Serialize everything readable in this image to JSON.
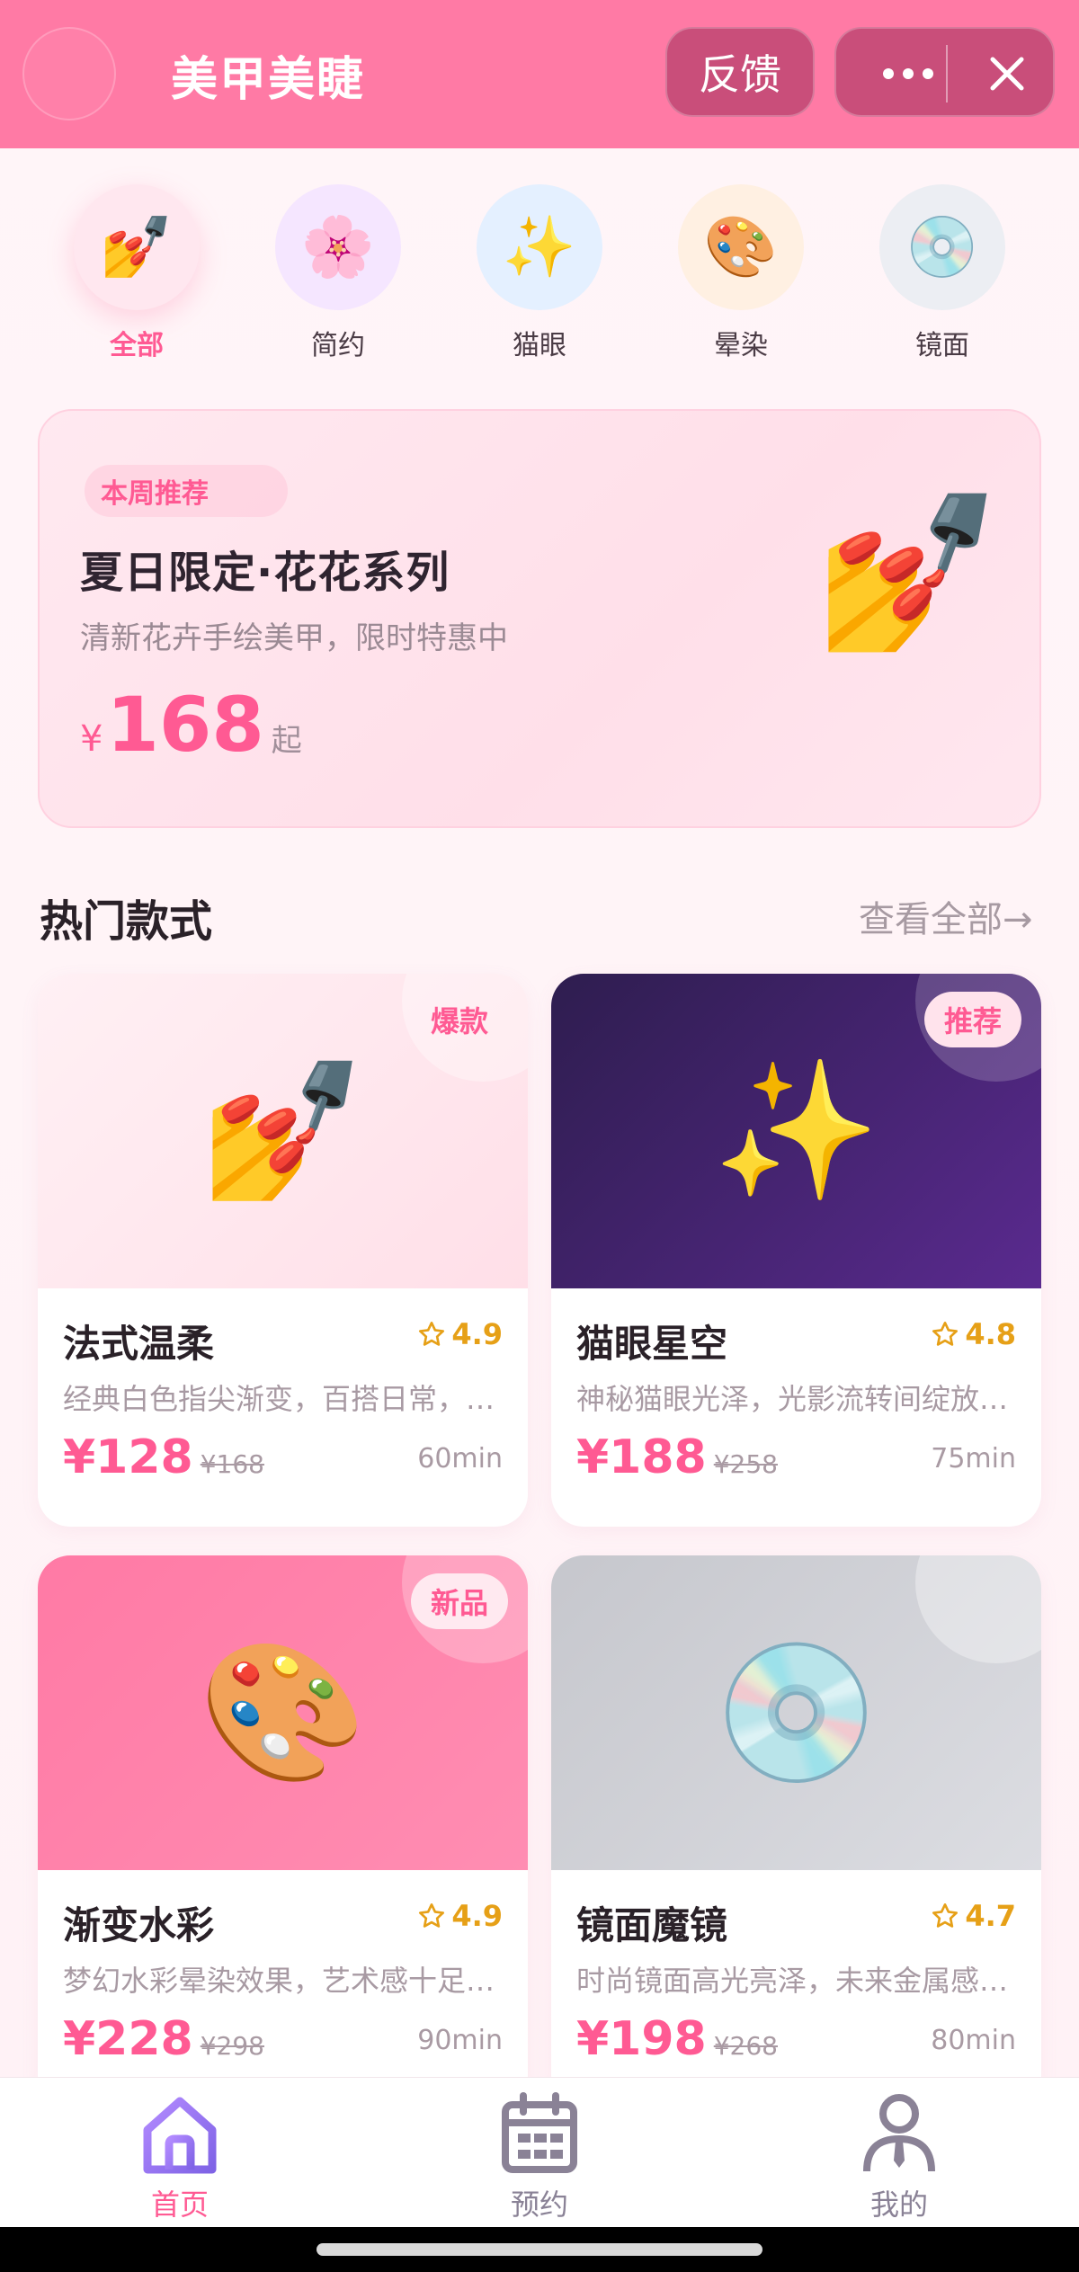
{
  "header": {
    "title": "美甲美睫",
    "feedback_label": "反馈",
    "header_color": "#ff7aa5"
  },
  "categories": [
    {
      "label": "全部",
      "icon": "nail-polish-icon",
      "glyph": "💅",
      "active": true
    },
    {
      "label": "简约",
      "icon": "cherry-blossom-icon",
      "glyph": "🌸",
      "active": false
    },
    {
      "label": "猫眼",
      "icon": "sparkles-icon",
      "glyph": "✨",
      "active": false
    },
    {
      "label": "晕染",
      "icon": "palette-icon",
      "glyph": "🎨",
      "active": false
    },
    {
      "label": "镜面",
      "icon": "dvd-disc-icon",
      "glyph": "💿",
      "active": false
    }
  ],
  "promo": {
    "tag": "本周推荐",
    "title": "夏日限定·花花系列",
    "subtitle": "清新花卉手绘美甲，限时特惠中",
    "price_symbol": "¥",
    "price": "168",
    "price_suffix": "起",
    "icon": "nail-polish-icon",
    "glyph": "💅"
  },
  "section": {
    "title": "热门款式",
    "more": "查看全部→"
  },
  "products": [
    {
      "name": "法式温柔",
      "badge": "爆款",
      "rating": "4.9",
      "desc": "经典白色指尖渐变，百搭日常，显白又优雅",
      "price": "¥128",
      "old_price": "¥168",
      "duration": "60min",
      "glyph": "💅",
      "icon": "nail-polish-icon"
    },
    {
      "name": "猫眼星空",
      "badge": "推荐",
      "rating": "4.8",
      "desc": "神秘猫眼光泽，光影流转间绽放星空之美",
      "price": "¥188",
      "old_price": "¥258",
      "duration": "75min",
      "glyph": "✨",
      "icon": "sparkles-icon"
    },
    {
      "name": "渐变水彩",
      "badge": "新品",
      "rating": "4.9",
      "desc": "梦幻水彩晕染效果，艺术感十足，独一无二",
      "price": "¥228",
      "old_price": "¥298",
      "duration": "90min",
      "glyph": "🎨",
      "icon": "palette-icon"
    },
    {
      "name": "镜面魔镜",
      "badge": "",
      "rating": "4.7",
      "desc": "时尚镜面高光亮泽，未来金属感十足",
      "price": "¥198",
      "old_price": "¥268",
      "duration": "80min",
      "glyph": "💿",
      "icon": "dvd-disc-icon"
    }
  ],
  "tabbar": [
    {
      "label": "首页",
      "icon": "home-icon",
      "active": true
    },
    {
      "label": "预约",
      "icon": "calendar-icon",
      "active": false
    },
    {
      "label": "我的",
      "icon": "user-icon",
      "active": false
    }
  ],
  "colors": {
    "accent": "#ff5a93",
    "tab_active": "#a07ee6",
    "rating": "#e6a017"
  }
}
